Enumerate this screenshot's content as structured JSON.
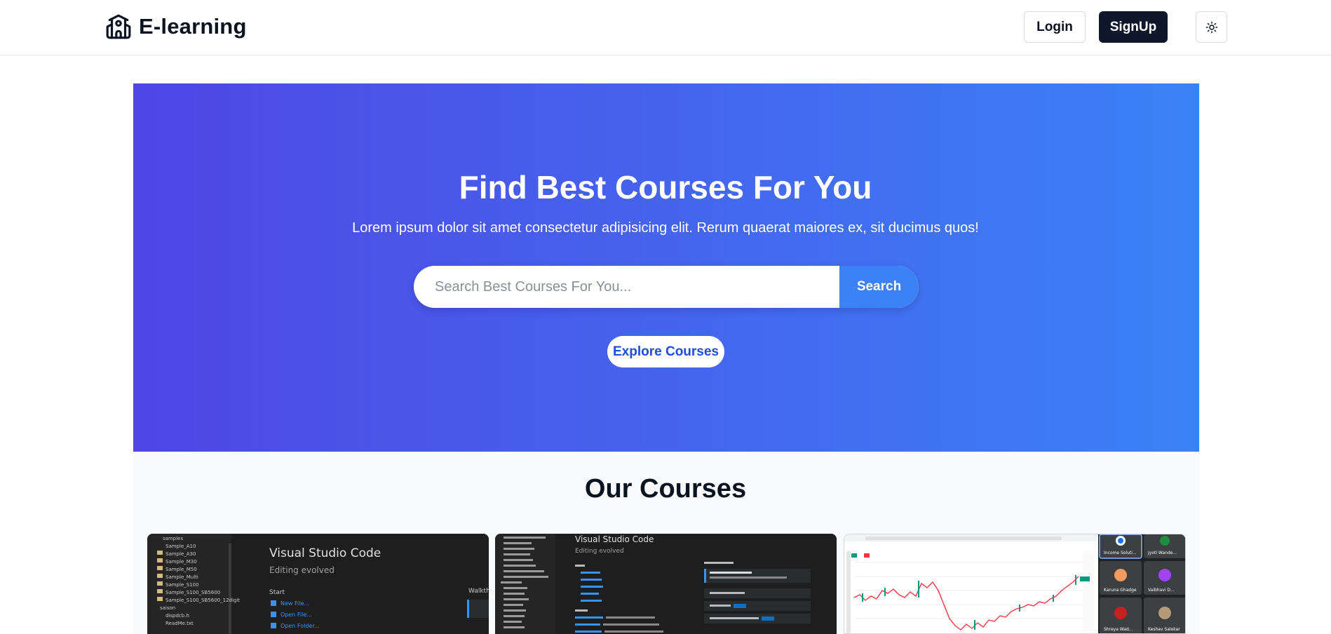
{
  "navbar": {
    "brand_title": "E-learning",
    "login_label": "Login",
    "signup_label": "SignUp",
    "theme_icon": "sun-icon"
  },
  "hero": {
    "title": "Find Best Courses For You",
    "subtitle": "Lorem ipsum dolor sit amet consectetur adipisicing elit. Rerum quaerat maiores ex, sit ducimus quos!",
    "search_placeholder": "Search Best Courses For You...",
    "search_button_label": "Search",
    "explore_button_label": "Explore Courses"
  },
  "courses": {
    "title": "Our Courses",
    "cards": [
      {
        "thumbnail": "vscode-welcome-screenshot",
        "heading": "Visual Studio Code",
        "subheading": "Editing evolved",
        "section": "Start",
        "links": [
          "New File...",
          "Open File...",
          "Open Folder..."
        ],
        "right_heading": "Walkth",
        "tree_items": [
          "samples",
          "Sample_A10",
          "Sample_A30",
          "Sample_M30",
          "Sample_M50",
          "Sample_Multi",
          "Sample_S100",
          "Sample_S100_SB5600",
          "Sample_S100_SB5600_12digit",
          "saison",
          "dispdcb.h",
          "ReadMe.txt"
        ]
      },
      {
        "thumbnail": "vscode-welcome-screenshot",
        "heading": "Visual Studio Code",
        "subheading": "Editing evolved"
      },
      {
        "thumbnail": "trading-chart-meeting-screenshot",
        "participants": [
          "Income Soluti...",
          "Jyoti Wande...",
          "Karuna Ghadge",
          "Vaibhavi D...",
          "Shreya Wad...",
          "Keshav Salekar"
        ]
      }
    ]
  },
  "colors": {
    "hero_gradient_start": "#4f46e5",
    "hero_gradient_end": "#3b82f6",
    "signup_bg": "#0f172a",
    "search_button_bg": "#3b82f6",
    "explore_text": "#1d4ed8"
  }
}
